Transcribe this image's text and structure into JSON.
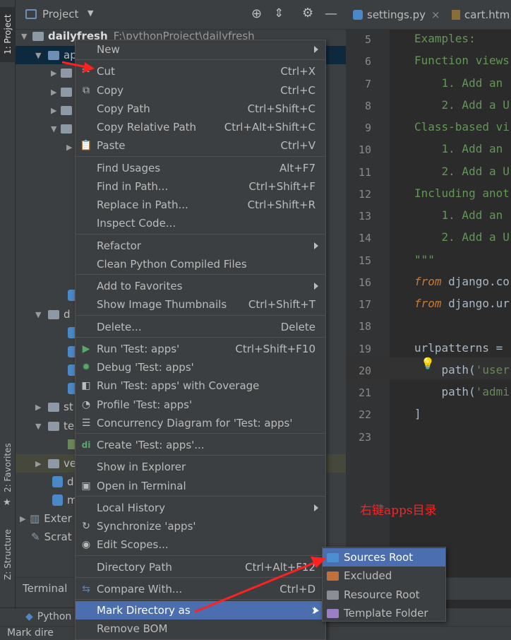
{
  "side_tabs": {
    "project": "1: Project",
    "favorites": "2: Favorites",
    "structure": "Z: Structure"
  },
  "project_panel": {
    "title": "Project",
    "root_name": "dailyfresh",
    "root_path": "F:\\pythonProject\\dailyfresh",
    "row_labels": {
      "apps": "ap",
      "d": "d",
      "st": "st",
      "te": "te",
      "ve": "ve",
      "d2": "d",
      "m": "m",
      "exter": "Exter",
      "scrat": "Scrat"
    }
  },
  "editor": {
    "tabs": [
      "settings.py",
      "cart.htm"
    ],
    "lines": [
      {
        "n": "5",
        "text": "Examples:"
      },
      {
        "n": "6",
        "text": "Function views"
      },
      {
        "n": "7",
        "text": "    1. Add an"
      },
      {
        "n": "8",
        "text": "    2. Add a U"
      },
      {
        "n": "9",
        "text": "Class-based vi"
      },
      {
        "n": "10",
        "text": "    1. Add an"
      },
      {
        "n": "11",
        "text": "    2. Add a U"
      },
      {
        "n": "12",
        "text": "Including anot"
      },
      {
        "n": "13",
        "text": "    1. Add an"
      },
      {
        "n": "14",
        "text": "    2. Add a U"
      },
      {
        "n": "15",
        "text": "\"\"\""
      },
      {
        "n": "16",
        "kw": "from",
        "rest": " django.co"
      },
      {
        "n": "17",
        "kw": "from",
        "rest": " django.ur"
      },
      {
        "n": "18",
        "text": ""
      },
      {
        "n": "19",
        "plain": "urlpatterns ="
      },
      {
        "n": "20",
        "fn": "    path(",
        "str": "'user"
      },
      {
        "n": "21",
        "fn": "    path(",
        "str": "'admi"
      },
      {
        "n": "22",
        "plain": "]"
      },
      {
        "n": "23",
        "text": ""
      }
    ]
  },
  "context_menu": {
    "new": "New",
    "cut": {
      "label": "Cut",
      "shortcut": "Ctrl+X"
    },
    "copy": {
      "label": "Copy",
      "shortcut": "Ctrl+C"
    },
    "copy_path": {
      "label": "Copy Path",
      "shortcut": "Ctrl+Shift+C"
    },
    "copy_relative_path": {
      "label": "Copy Relative Path",
      "shortcut": "Ctrl+Alt+Shift+C"
    },
    "paste": {
      "label": "Paste",
      "shortcut": "Ctrl+V"
    },
    "find_usages": {
      "label": "Find Usages",
      "shortcut": "Alt+F7"
    },
    "find_in_path": {
      "label": "Find in Path...",
      "shortcut": "Ctrl+Shift+F"
    },
    "replace_in_path": {
      "label": "Replace in Path...",
      "shortcut": "Ctrl+Shift+R"
    },
    "inspect_code": {
      "label": "Inspect Code..."
    },
    "refactor": {
      "label": "Refactor"
    },
    "clean_python": {
      "label": "Clean Python Compiled Files"
    },
    "add_to_favorites": {
      "label": "Add to Favorites"
    },
    "show_image_thumbnails": {
      "label": "Show Image Thumbnails",
      "shortcut": "Ctrl+Shift+T"
    },
    "delete": {
      "label": "Delete...",
      "shortcut": "Delete"
    },
    "run": {
      "label": "Run 'Test: apps'",
      "shortcut": "Ctrl+Shift+F10"
    },
    "debug": {
      "label": "Debug 'Test: apps'"
    },
    "run_coverage": {
      "label": "Run 'Test: apps' with Coverage"
    },
    "profile": {
      "label": "Profile 'Test: apps'"
    },
    "concurrency": {
      "label": "Concurrency Diagram for 'Test: apps'"
    },
    "create": {
      "label": "Create 'Test: apps'..."
    },
    "show_in_explorer": {
      "label": "Show in Explorer"
    },
    "open_in_terminal": {
      "label": "Open in Terminal"
    },
    "local_history": {
      "label": "Local History"
    },
    "synchronize": {
      "label": "Synchronize 'apps'"
    },
    "edit_scopes": {
      "label": "Edit Scopes..."
    },
    "directory_path": {
      "label": "Directory Path",
      "shortcut": "Ctrl+Alt+F12"
    },
    "compare_with": {
      "label": "Compare With...",
      "shortcut": "Ctrl+D"
    },
    "mark_directory_as": {
      "label": "Mark Directory as"
    },
    "remove_bom": {
      "label": "Remove BOM"
    }
  },
  "submenu": {
    "sources_root": {
      "label": "Sources Root",
      "color": "#4a8fd0"
    },
    "excluded": {
      "label": "Excluded",
      "color": "#c16f3b"
    },
    "resource_root": {
      "label": "Resource Root",
      "color": "#8b8f94"
    },
    "template_folder": {
      "label": "Template Folder",
      "color": "#9a7fc4"
    }
  },
  "bottom": {
    "terminal": "Terminal",
    "python": "Python",
    "status": "Mark dire"
  },
  "annotation": "右键apps目录",
  "colors": {
    "selection": "#4b6eaf",
    "panel": "#3c3f41",
    "editor_bg": "#2b2b2b",
    "annotation": "#ff2020"
  }
}
